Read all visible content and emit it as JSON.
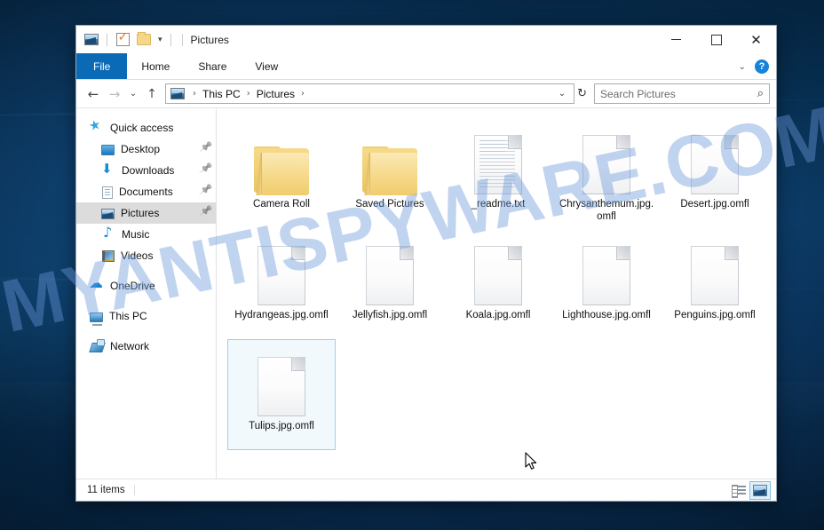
{
  "window": {
    "title": "Pictures",
    "quick_access_toolbar": [
      {
        "name": "window-menu-icon",
        "label": "Properties"
      },
      {
        "name": "properties-icon",
        "label": "Properties"
      },
      {
        "name": "new-folder-icon",
        "label": "New folder"
      },
      {
        "name": "customize-qat-caret",
        "label": "▾"
      }
    ],
    "controls": {
      "minimize": "—",
      "maximize": "□",
      "close": "✕"
    }
  },
  "ribbon": {
    "tabs": [
      {
        "label": "File",
        "active": true
      },
      {
        "label": "Home",
        "active": false
      },
      {
        "label": "Share",
        "active": false
      },
      {
        "label": "View",
        "active": false
      }
    ],
    "expand_caret": "⌄",
    "help_label": "?"
  },
  "addressbar": {
    "back": "←",
    "forward": "→",
    "history": "⌄",
    "up": "↑",
    "breadcrumbs": [
      "This PC",
      "Pictures"
    ],
    "separator": "›",
    "dropdown_caret": "⌄",
    "refresh": "↻"
  },
  "search": {
    "placeholder": "Search Pictures",
    "value": "",
    "icon": "search-icon"
  },
  "navpane": {
    "items": [
      {
        "label": "Quick access",
        "icon": "star-icon",
        "indent": false,
        "pinned": false,
        "selected": false
      },
      {
        "label": "Desktop",
        "icon": "desktop-icon",
        "indent": true,
        "pinned": true,
        "selected": false
      },
      {
        "label": "Downloads",
        "icon": "download-icon",
        "indent": true,
        "pinned": true,
        "selected": false
      },
      {
        "label": "Documents",
        "icon": "document-icon",
        "indent": true,
        "pinned": true,
        "selected": false
      },
      {
        "label": "Pictures",
        "icon": "picture-icon",
        "indent": true,
        "pinned": true,
        "selected": true
      },
      {
        "label": "Music",
        "icon": "music-icon",
        "indent": true,
        "pinned": false,
        "selected": false
      },
      {
        "label": "Videos",
        "icon": "video-icon",
        "indent": true,
        "pinned": false,
        "selected": false
      },
      {
        "label": "OneDrive",
        "icon": "cloud-icon",
        "indent": false,
        "pinned": false,
        "selected": false,
        "gap_before": true
      },
      {
        "label": "This PC",
        "icon": "pc-icon",
        "indent": false,
        "pinned": false,
        "selected": false,
        "gap_before": true
      },
      {
        "label": "Network",
        "icon": "network-icon",
        "indent": false,
        "pinned": false,
        "selected": false,
        "gap_before": true
      }
    ]
  },
  "files": [
    {
      "name": "Camera Roll",
      "type": "folder",
      "selected": false
    },
    {
      "name": "Saved Pictures",
      "type": "folder",
      "selected": false
    },
    {
      "name": "_readme.txt",
      "type": "text",
      "selected": false
    },
    {
      "name": "Chrysanthemum.jpg.omfl",
      "type": "file",
      "selected": false
    },
    {
      "name": "Desert.jpg.omfl",
      "type": "file",
      "selected": false
    },
    {
      "name": "Hydrangeas.jpg.omfl",
      "type": "file",
      "selected": false
    },
    {
      "name": "Jellyfish.jpg.omfl",
      "type": "file",
      "selected": false
    },
    {
      "name": "Koala.jpg.omfl",
      "type": "file",
      "selected": false
    },
    {
      "name": "Lighthouse.jpg.omfl",
      "type": "file",
      "selected": false
    },
    {
      "name": "Penguins.jpg.omfl",
      "type": "file",
      "selected": false
    },
    {
      "name": "Tulips.jpg.omfl",
      "type": "file",
      "selected": true
    }
  ],
  "statusbar": {
    "item_count": "11 items",
    "views": [
      {
        "name": "details-view-button",
        "active": false
      },
      {
        "name": "large-icons-view-button",
        "active": true
      }
    ]
  },
  "desktop": {
    "watermark": "MYANTISPYWARE.COM"
  },
  "colors": {
    "accent": "#0b6ab5",
    "selection_border": "#9cd1ef",
    "folder_yellow": "#f2d071",
    "desktop_blue": "#073257"
  }
}
